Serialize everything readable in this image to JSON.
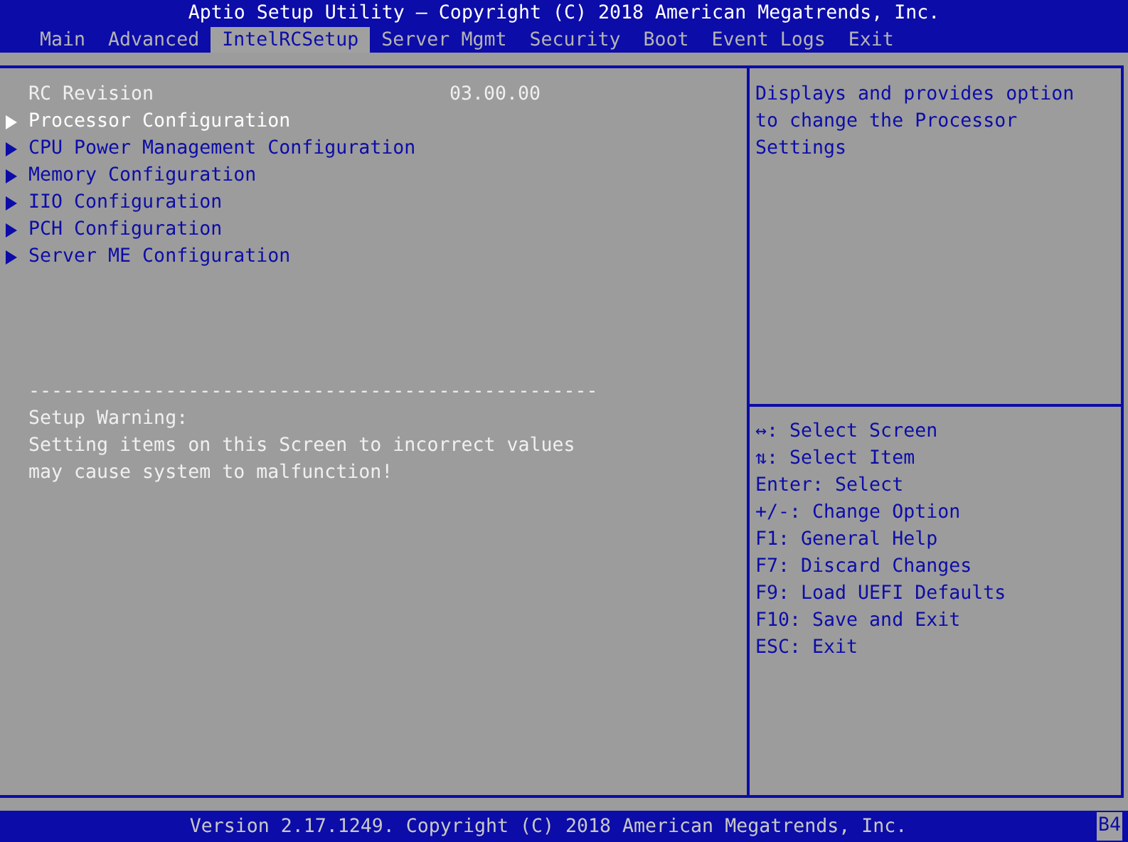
{
  "title": "Aptio Setup Utility – Copyright (C) 2018 American Megatrends, Inc.",
  "tabs": [
    {
      "label": "Main",
      "selected": false
    },
    {
      "label": "Advanced",
      "selected": false
    },
    {
      "label": "IntelRCSetup",
      "selected": true
    },
    {
      "label": "Server Mgmt",
      "selected": false
    },
    {
      "label": "Security",
      "selected": false
    },
    {
      "label": "Boot",
      "selected": false
    },
    {
      "label": "Event Logs",
      "selected": false
    },
    {
      "label": "Exit",
      "selected": false
    }
  ],
  "items": [
    {
      "kind": "info",
      "label": "RC Revision",
      "value": "03.00.00"
    },
    {
      "kind": "submenu",
      "label": "Processor Configuration",
      "selected": true
    },
    {
      "kind": "submenu",
      "label": "CPU Power Management Configuration",
      "selected": false
    },
    {
      "kind": "submenu",
      "label": "Memory Configuration",
      "selected": false
    },
    {
      "kind": "submenu",
      "label": "IIO Configuration",
      "selected": false
    },
    {
      "kind": "submenu",
      "label": "PCH Configuration",
      "selected": false
    },
    {
      "kind": "submenu",
      "label": "Server ME Configuration",
      "selected": false
    }
  ],
  "separator": "--------------------------------------------------",
  "warning": [
    "Setup Warning:",
    "Setting items on this Screen to incorrect values",
    "may cause system to malfunction!"
  ],
  "help": [
    "Displays and provides option",
    "to change the Processor",
    "Settings"
  ],
  "keys": [
    "↔: Select Screen",
    "⇅: Select Item",
    "Enter: Select",
    "+/-: Change Option",
    "F1: General Help",
    "F7: Discard Changes",
    "F9: Load UEFI Defaults",
    "F10: Save and Exit",
    "ESC: Exit"
  ],
  "footer": "Version 2.17.1249. Copyright (C) 2018 American Megatrends, Inc.",
  "badge": "B4"
}
